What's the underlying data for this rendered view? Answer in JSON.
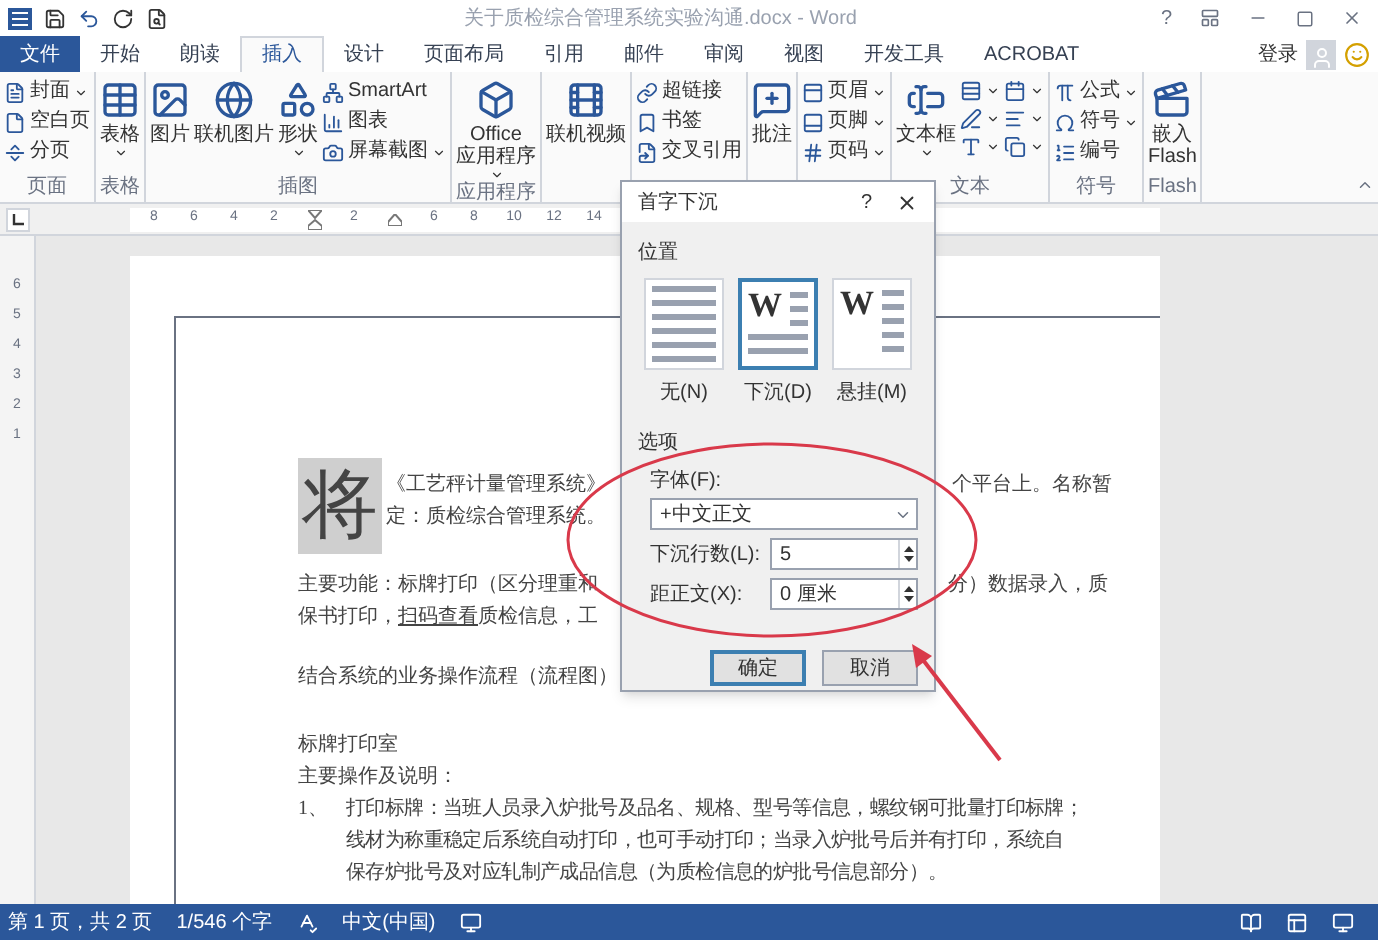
{
  "window": {
    "title": "关于质检综合管理系统实验沟通.docx - Word",
    "help": "?"
  },
  "tabs": [
    {
      "label": "文件",
      "kind": "file",
      "selected": false
    },
    {
      "label": "开始",
      "kind": "tab",
      "selected": false
    },
    {
      "label": "朗读",
      "kind": "tab",
      "selected": false
    },
    {
      "label": "插入",
      "kind": "tab",
      "selected": true
    },
    {
      "label": "设计",
      "kind": "tab",
      "selected": false
    },
    {
      "label": "页面布局",
      "kind": "tab",
      "selected": false
    },
    {
      "label": "引用",
      "kind": "tab",
      "selected": false
    },
    {
      "label": "邮件",
      "kind": "tab",
      "selected": false
    },
    {
      "label": "审阅",
      "kind": "tab",
      "selected": false
    },
    {
      "label": "视图",
      "kind": "tab",
      "selected": false
    },
    {
      "label": "开发工具",
      "kind": "tab",
      "selected": false
    },
    {
      "label": "ACROBAT",
      "kind": "tab",
      "selected": false
    }
  ],
  "account": {
    "label": "登录"
  },
  "ribbon": {
    "groups": [
      {
        "label": "页面",
        "items": [
          {
            "kind": "small",
            "label": "封面",
            "dropdown": true
          },
          {
            "kind": "small",
            "label": "空白页",
            "dropdown": false
          },
          {
            "kind": "small",
            "label": "分页",
            "dropdown": false
          }
        ]
      },
      {
        "label": "表格",
        "items": [
          {
            "kind": "large",
            "label": "表格",
            "dropdown": true
          }
        ]
      },
      {
        "label": "插图",
        "items": [
          {
            "kind": "large",
            "label": "图片",
            "dropdown": false
          },
          {
            "kind": "large",
            "label": "联机图片",
            "dropdown": false
          },
          {
            "kind": "large",
            "label": "形状",
            "dropdown": true
          },
          {
            "kind": "small",
            "label": "SmartArt",
            "dropdown": false
          },
          {
            "kind": "small",
            "label": "图表",
            "dropdown": false
          },
          {
            "kind": "small",
            "label": "屏幕截图",
            "dropdown": true
          }
        ]
      },
      {
        "label": "应用程序",
        "items": [
          {
            "kind": "large",
            "label": "Office\n应用程序",
            "dropdown": true
          }
        ]
      },
      {
        "items": [
          {
            "kind": "large",
            "label": "联机视频",
            "dropdown": false
          }
        ]
      },
      {
        "items": [
          {
            "kind": "small",
            "label": "超链接",
            "dropdown": false
          },
          {
            "kind": "small",
            "label": "书签",
            "dropdown": false
          },
          {
            "kind": "small",
            "label": "交叉引用",
            "dropdown": false
          }
        ]
      },
      {
        "items": [
          {
            "kind": "large",
            "label": "批注",
            "dropdown": false
          }
        ]
      },
      {
        "items": [
          {
            "kind": "small",
            "label": "页眉",
            "dropdown": true
          },
          {
            "kind": "small",
            "label": "页脚",
            "dropdown": true
          },
          {
            "kind": "small",
            "label": "页码",
            "dropdown": true
          }
        ]
      },
      {
        "label": "文本",
        "items": [
          {
            "kind": "large",
            "label": "文本框",
            "dropdown": true
          },
          {
            "kind": "icon",
            "dropdown": true
          },
          {
            "kind": "icon",
            "dropdown": true
          },
          {
            "kind": "icon",
            "dropdown": true
          },
          {
            "kind": "icon",
            "dropdown": true
          },
          {
            "kind": "icon",
            "dropdown": true
          },
          {
            "kind": "icon",
            "dropdown": true
          }
        ]
      },
      {
        "label": "符号",
        "items": [
          {
            "kind": "small",
            "label": "公式",
            "dropdown": true
          },
          {
            "kind": "small",
            "label": "符号",
            "dropdown": true
          },
          {
            "kind": "small",
            "label": "编号",
            "dropdown": false
          }
        ]
      },
      {
        "label": "Flash",
        "items": [
          {
            "kind": "large",
            "label": "嵌入\nFlash",
            "dropdown": false
          }
        ]
      }
    ]
  },
  "ruler": {
    "ticks": [
      {
        "kind": "number",
        "label": "8"
      },
      {
        "kind": "number",
        "label": "6"
      },
      {
        "kind": "number",
        "label": "4"
      },
      {
        "kind": "number",
        "label": "2"
      },
      {
        "kind": "indent"
      },
      {
        "kind": "number",
        "label": "2"
      },
      {
        "kind": "hanging"
      },
      {
        "kind": "number",
        "label": "6"
      },
      {
        "kind": "number",
        "label": "8"
      },
      {
        "kind": "number",
        "label": "10"
      },
      {
        "kind": "number",
        "label": "12"
      },
      {
        "kind": "number",
        "label": "14"
      }
    ],
    "vertical_ticks": [
      "6",
      "5",
      "4",
      "3",
      "2",
      "1"
    ]
  },
  "document": {
    "drop_cap": "将",
    "drop_cap_lines": [
      {
        "left": "《工艺秤计量管理系统》",
        "right": "个平台上。名称暂"
      },
      {
        "left": "定：质检综合管理系统。"
      }
    ],
    "paragraph_lines": [
      {
        "left": "主要功能：标牌打印（区分理重和",
        "right": "分）数据录入，质"
      },
      {
        "left": "保书打印，",
        "link": "扫码查看",
        "after": "质检信息，工"
      }
    ],
    "flow_heading": "结合系统的业务操作流程（流程图）",
    "section_title": "标牌打印室",
    "section_subtitle": "主要操作及说明：",
    "list": [
      {
        "marker": "1、",
        "lines": [
          "打印标牌：当班人员录入炉批号及品名、规格、型号等信息，螺纹钢可批量打印标牌；",
          "线材为称重稳定后系统自动打印，也可手动打印；当录入炉批号后并有打印，系统自",
          "保存炉批号及对应轧制产成品信息（为质检信息的炉批号信息部分）。"
        ]
      }
    ]
  },
  "dialog": {
    "title": "首字下沉",
    "help": "?",
    "position_label": "位置",
    "positions": [
      {
        "kind": "none",
        "label": "无(N)",
        "selected": false
      },
      {
        "kind": "dropped",
        "label": "下沉(D)",
        "letter": "W",
        "selected": true
      },
      {
        "kind": "margin",
        "label": "悬挂(M)",
        "letter": "W",
        "selected": false
      }
    ],
    "options_label": "选项",
    "font_label": "字体(F):",
    "font_value": "+中文正文",
    "lines_label": "下沉行数(L):",
    "lines_value": "5",
    "distance_label": "距正文(X):",
    "distance_value": "0 厘米",
    "buttons": [
      {
        "label": "确定",
        "kind": "default"
      },
      {
        "label": "取消",
        "kind": "normal"
      }
    ]
  },
  "status_bar": {
    "page": "第 1 页，共 2 页",
    "words": "1/546 个字",
    "language": "中文(中国)"
  }
}
